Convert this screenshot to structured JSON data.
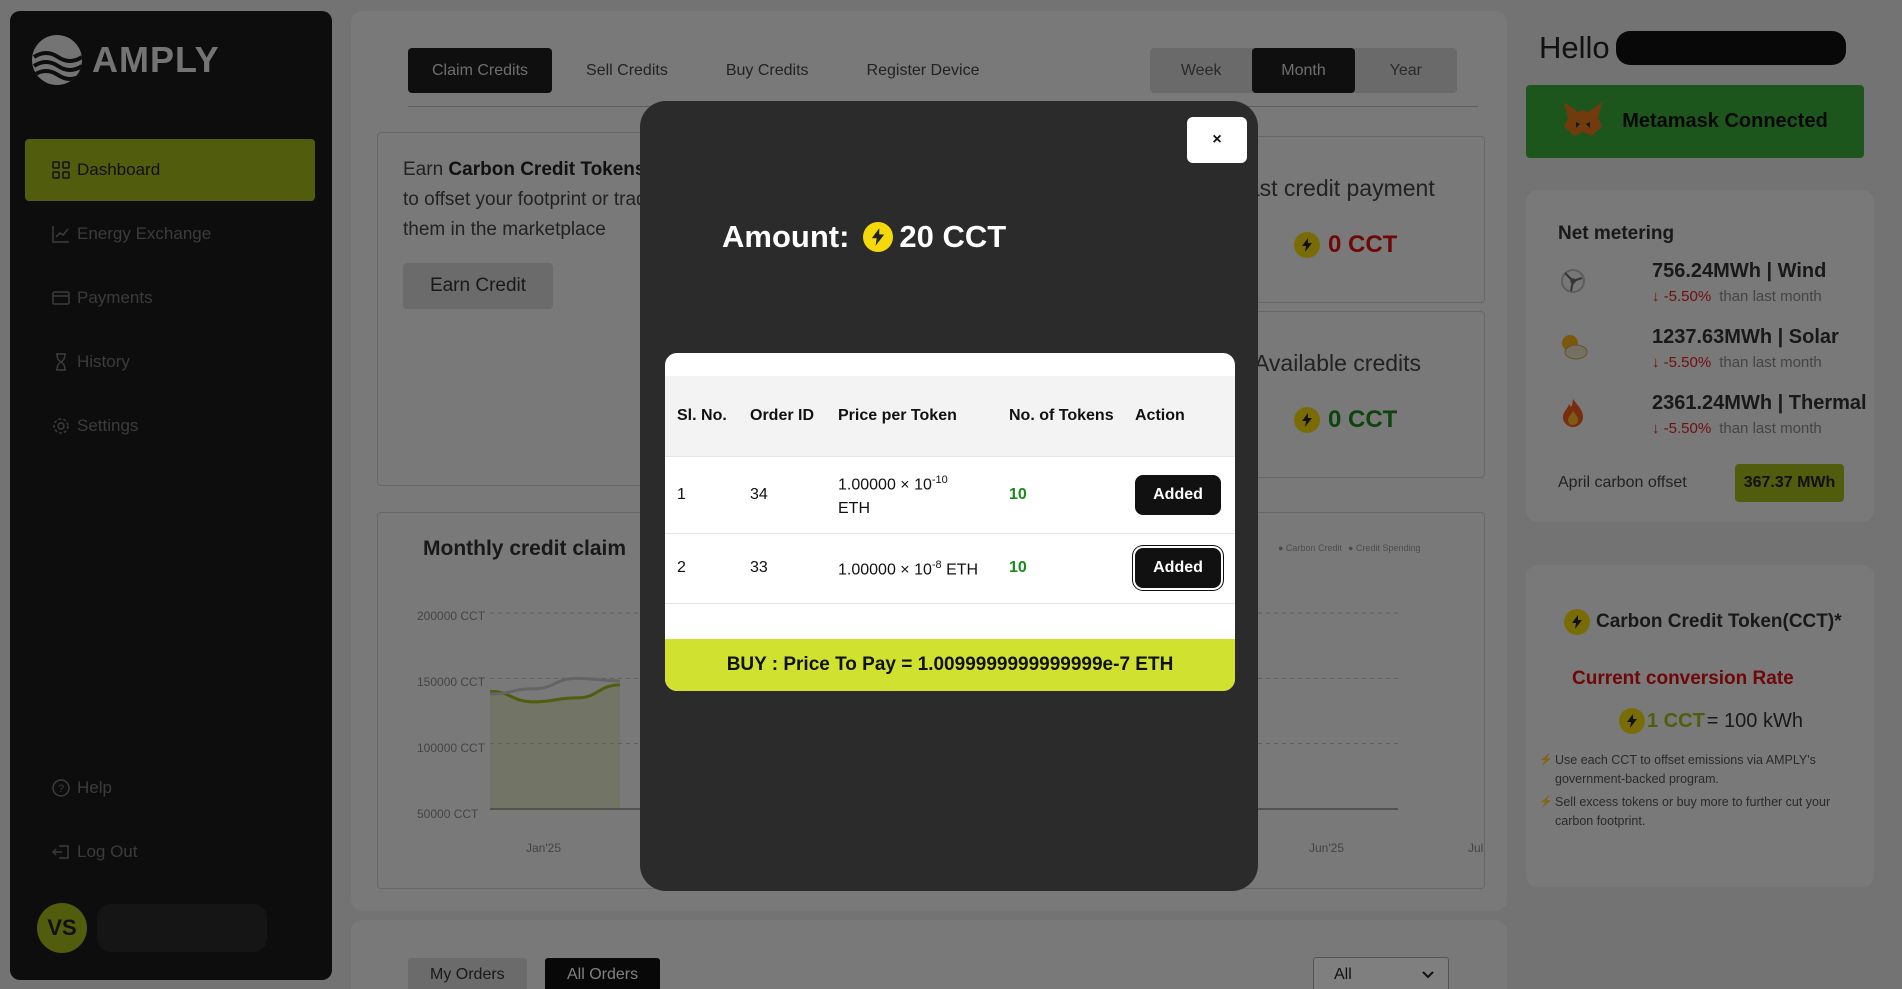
{
  "sidebar": {
    "brand": "AMPLY",
    "items": [
      {
        "label": "Dashboard",
        "icon": "grid-icon"
      },
      {
        "label": "Energy Exchange",
        "icon": "chart-line-icon"
      },
      {
        "label": "Payments",
        "icon": "credit-card-icon"
      },
      {
        "label": "History",
        "icon": "hourglass-icon"
      },
      {
        "label": "Settings",
        "icon": "gear-icon"
      }
    ],
    "bottom_items": [
      {
        "label": "Help",
        "icon": "question-icon"
      },
      {
        "label": "Log Out",
        "icon": "logout-icon"
      }
    ],
    "user_initials": "VS"
  },
  "tabs": {
    "items": [
      "Claim Credits",
      "Sell Credits",
      "Buy Credits",
      "Register Device"
    ],
    "active": "Claim Credits"
  },
  "period": {
    "items": [
      "Week",
      "Month",
      "Year"
    ],
    "active": "Month"
  },
  "earn_card": {
    "text_prefix": "Earn ",
    "text_bold": "Carbon Credit Tokens",
    "text_suffix": " to offset your footprint or trade them in the marketplace",
    "button": "Earn Credit"
  },
  "chart": {
    "title": "Monthly credit claim",
    "legend": [
      "Carbon Credit",
      "Credit Spending"
    ]
  },
  "chart_data": {
    "type": "area",
    "title": "Monthly credit claim",
    "y_tick_labels": [
      "200000 CCT",
      "150000 CCT",
      "100000 CCT",
      "50000 CCT"
    ],
    "x_tick_labels": [
      "Jan'25",
      "Jun'25",
      "Jul"
    ],
    "series": [
      {
        "name": "Carbon Credit",
        "values": [
          140000,
          132000,
          135000,
          145000
        ]
      },
      {
        "name": "Credit Spending",
        "values": [
          138000,
          142000,
          150000,
          148000
        ]
      }
    ]
  },
  "stats": {
    "last_payment_title": "Last credit payment",
    "last_payment_value": "0 CCT",
    "available_title": "Available credits",
    "available_value": "0 CCT"
  },
  "lower": {
    "tabs": [
      "My Orders",
      "All Orders"
    ],
    "active": "All Orders",
    "filter": "All"
  },
  "right": {
    "greeting": "Hello",
    "metamask": "Metamask Connected",
    "net_metering_title": "Net metering",
    "net_rows": [
      {
        "value": "756.24MWh | Wind",
        "change": "-5.50%",
        "note": "than last month",
        "icon": "wind-turbine-icon"
      },
      {
        "value": "1237.63MWh | Solar",
        "change": "-5.50%",
        "note": "than last month",
        "icon": "sun-cloud-icon"
      },
      {
        "value": "2361.24MWh | Thermal",
        "change": "-5.50%",
        "note": "than last month",
        "icon": "flame-icon"
      }
    ],
    "offset_label": "April carbon offset",
    "offset_value": "367.37 MWh",
    "cct_title": "Carbon Credit Token(CCT)*",
    "rate_title": "Current conversion Rate",
    "rate_left": "1 CCT",
    "rate_right": "= 100 kWh",
    "bullets": [
      "Use each CCT to offset emissions via AMPLY's government-backed program.",
      "Sell excess tokens or buy more to further cut your carbon footprint."
    ]
  },
  "modal": {
    "close": "×",
    "amount_label": "Amount:",
    "amount_value": "20 CCT",
    "headers": {
      "sl_no": "Sl. No.",
      "order_id": "Order ID",
      "price": "Price per Token",
      "tokens": "No. of Tokens",
      "action": "Action"
    },
    "rows": [
      {
        "sl": "1",
        "order_id": "34",
        "price_mant": "1.00000 × 10",
        "price_exp": "-10",
        "price_unit": "ETH",
        "tokens": "10",
        "action": "Added"
      },
      {
        "sl": "2",
        "order_id": "33",
        "price_mant": "1.00000 × 10",
        "price_exp": "-8",
        "price_unit": "ETH",
        "tokens": "10",
        "action": "Added"
      }
    ],
    "buy_text": "BUY : Price To Pay = 1.0099999999999999e-7 ETH"
  },
  "colors": {
    "accent": "#a3b81a",
    "sidebar": "#1b1b1b",
    "modal": "#2b2b2b",
    "buy_bar": "#d0e22f",
    "metamask": "#3aac3a",
    "negative": "#d11111",
    "positive": "#1a8a1a"
  }
}
